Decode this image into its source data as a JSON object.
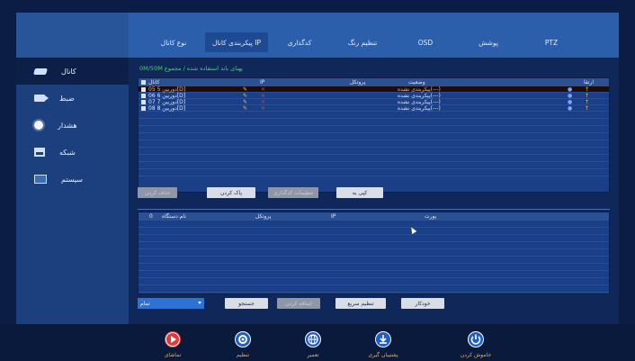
{
  "sidebar": {
    "items": [
      {
        "label": "کانال",
        "icon": "camera-icon"
      },
      {
        "label": "ضبط",
        "icon": "record-icon"
      },
      {
        "label": "هشدار",
        "icon": "alarm-icon"
      },
      {
        "label": "شبکه",
        "icon": "network-icon"
      },
      {
        "label": "سیستم",
        "icon": "system-icon"
      }
    ]
  },
  "tabs": [
    "نوع کانال",
    "پیکربندی کانال IP",
    "کدگذاری",
    "تنظیم رنگ",
    "OSD",
    "پوشش",
    "PTZ"
  ],
  "info_line": "0M/50M پهنای باند استفاده شده / مجموع",
  "channel_table": {
    "headers": {
      "channel": "کانال",
      "ip": "IP",
      "protocol": "پروتکل",
      "status": "وضعیت",
      "upgrade": "ارتقا"
    },
    "rows": [
      {
        "name": "دوربین 5 05[D]",
        "status": "پیکربندی نشده(---)"
      },
      {
        "name": "دوربین 6 06[D]",
        "status": "پیکربندی نشده(---)"
      },
      {
        "name": "دوربین 7 07[D]",
        "status": "پیکربندی نشده(---)"
      },
      {
        "name": "دوربین 8 08[D]",
        "status": "پیکربندی نشده(---)"
      }
    ]
  },
  "buttons_top": {
    "delete": "حذف کردن",
    "clear": "پاک کردن",
    "encode_settings": "تنظیمات کدگذاری",
    "copy_to": "کپی به"
  },
  "device_table": {
    "headers": {
      "num": "0",
      "device_name": "نام دستگاه",
      "protocol": "پروتکل",
      "ip": "IP",
      "port": "پورت"
    }
  },
  "buttons_bottom": {
    "filter_value": "تمام",
    "search": "جستجو",
    "add": "اضافه کردن",
    "quick_setup": "تنظیم سریع",
    "auto": "خودکار"
  },
  "bottom_nav": [
    {
      "label": "تماشای",
      "icon": "play-icon"
    },
    {
      "label": "تنظیم",
      "icon": "settings-icon"
    },
    {
      "label": "تعمیر",
      "icon": "globe-icon"
    },
    {
      "label": "پشتیبان گیری",
      "icon": "backup-icon"
    },
    {
      "label": "خاموش کردن",
      "icon": "power-icon"
    }
  ],
  "colors": {
    "accent": "#2f72d6",
    "label_orange": "#f0b43a",
    "status_green": "#43d16a"
  }
}
